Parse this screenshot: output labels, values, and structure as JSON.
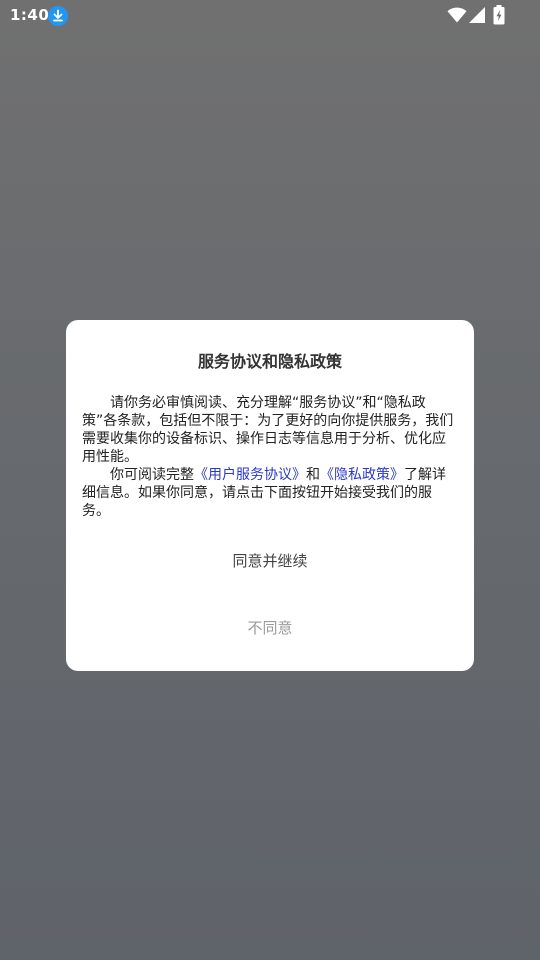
{
  "status_bar": {
    "time": "1:40"
  },
  "dialog": {
    "title": "服务协议和隐私政策",
    "paragraph1": "请你务必审慎阅读、充分理解“服务协议”和“隐私政策”各条款，包括但不限于：为了更好的向你提供服务，我们需要收集你的设备标识、操作日志等信息用于分析、优化应用性能。",
    "paragraph2": {
      "prefix": "你可阅读完整",
      "link1": "《用户服务协议》",
      "middle": "和",
      "link2": "《隐私政策》",
      "suffix": "了解详细信息。如果你同意，请点击下面按钮开始接受我们的服务。"
    },
    "agree_label": "同意并继续",
    "disagree_label": "不同意"
  },
  "colors": {
    "link": "#2b38c9",
    "download_badge": "#2196f3"
  },
  "icons": {
    "notification": "download-icon",
    "wifi": "wifi-icon",
    "signal": "signal-icon",
    "battery": "battery-charging-icon"
  }
}
